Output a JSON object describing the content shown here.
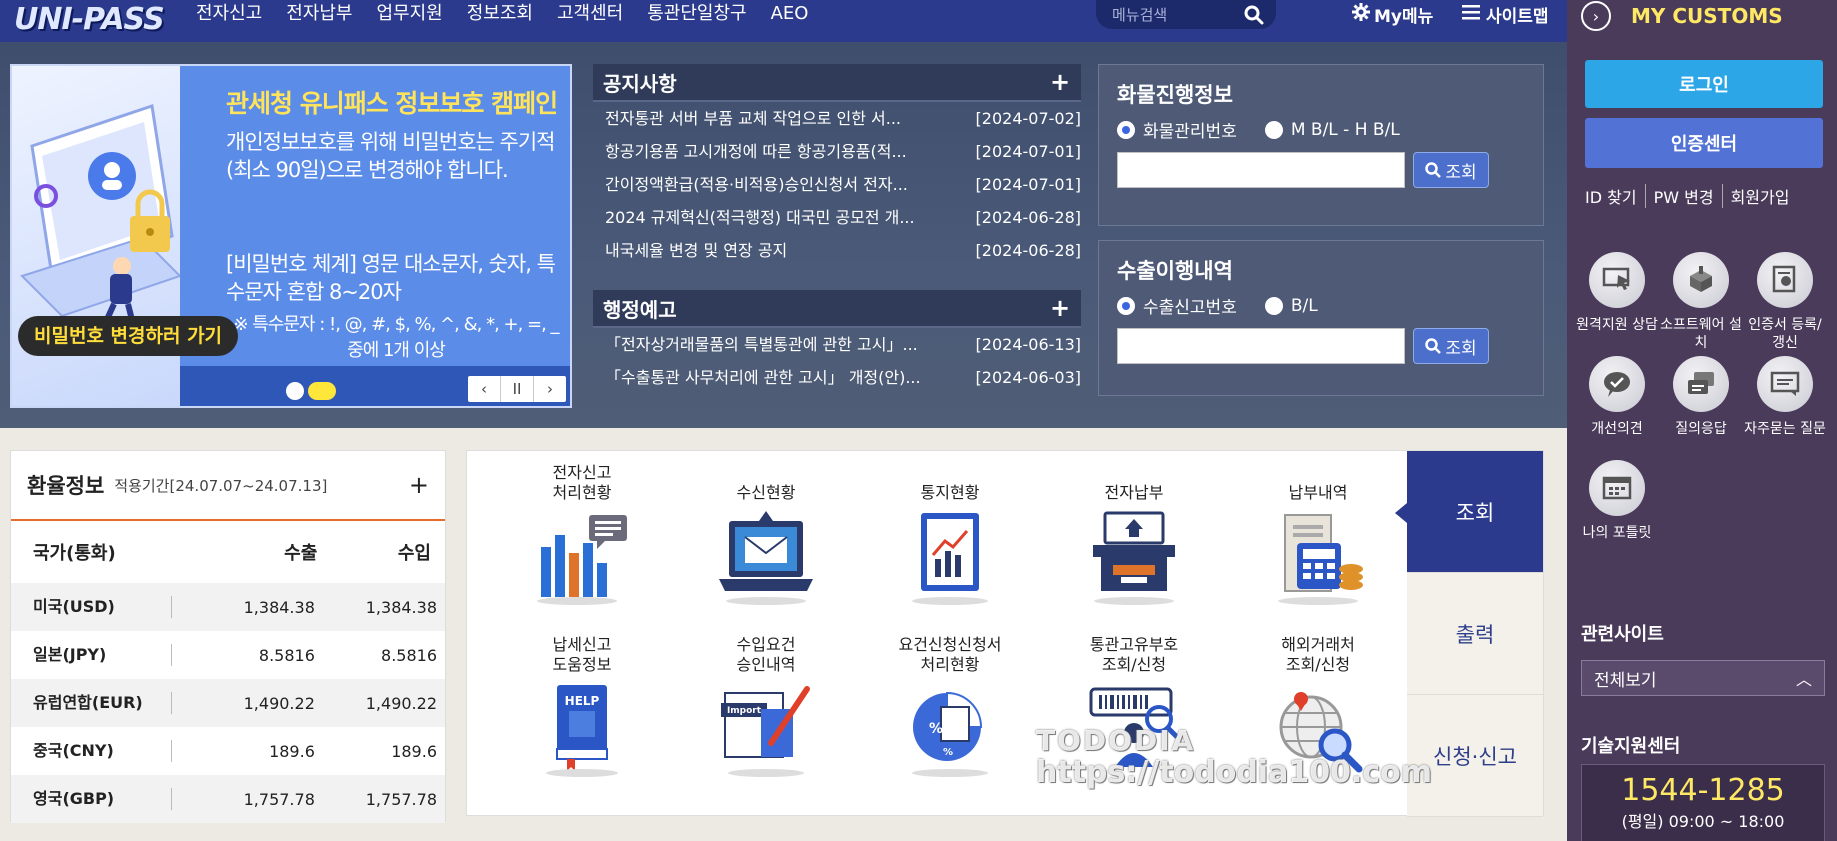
{
  "nav": {
    "logo": "UNI-PASS",
    "menu": [
      "전자신고",
      "전자납부",
      "업무지원",
      "정보조회",
      "고객센터",
      "통관단일창구",
      "AEO"
    ],
    "search_placeholder": "메뉴검색",
    "my_menu": "My메뉴",
    "site_map": "사이트맵"
  },
  "banner": {
    "title": "관세청 유니패스 정보보호 캠페인",
    "text1": "개인정보보호를 위해 비밀번호는 주기적(최소 90일)으로 변경해야 합니다.",
    "text2": "[비밀번호 체계] 영문 대소문자, 숫자, 특수문자 혼합 8~20자",
    "text3": "※ 특수문자 : !, @, #, $, %, ^, &, *, +, =, _ 중에 1개 이상",
    "cta": "비밀번호 변경하러 가기",
    "controls": [
      "‹",
      "II",
      "›"
    ],
    "active_slide_index": 1
  },
  "notice": {
    "title": "공지사항",
    "more": "+",
    "items": [
      {
        "title": "전자통관 서버 부품 교체 작업으로 인한 서...",
        "date": "[2024-07-02]"
      },
      {
        "title": "항공기용품 고시개정에 따른 항공기용품(적...",
        "date": "[2024-07-01]"
      },
      {
        "title": "간이정액환급(적용·비적용)승인신청서 전자...",
        "date": "[2024-07-01]"
      },
      {
        "title": "2024 규제혁신(적극행정) 대국민 공모전 개...",
        "date": "[2024-06-28]"
      },
      {
        "title": "내국세율 변경 및 연장 공지",
        "date": "[2024-06-28]"
      }
    ]
  },
  "admin_notice": {
    "title": "행정예고",
    "more": "+",
    "items": [
      {
        "title": "「전자상거래물품의 특별통관에 관한 고시」...",
        "date": "[2024-06-13]"
      },
      {
        "title": "「수출통관 사무처리에 관한 고시」 개정(안)...",
        "date": "[2024-06-03]"
      }
    ]
  },
  "cargo": {
    "title": "화물진행정보",
    "options": [
      "화물관리번호",
      "M B/L - H B/L"
    ],
    "selected": 0,
    "button": "조회"
  },
  "export": {
    "title": "수출이행내역",
    "options": [
      "수출신고번호",
      "B/L"
    ],
    "selected": 0,
    "button": "조회"
  },
  "fx": {
    "title": "환율정보",
    "period": "적용기간[24.07.07~24.07.13]",
    "more": "+",
    "columns": [
      "국가(통화)",
      "수출",
      "수입"
    ],
    "rows": [
      {
        "country": "미국(USD)",
        "export": "1,384.38",
        "import": "1,384.38"
      },
      {
        "country": "일본(JPY)",
        "export": "8.5816",
        "import": "8.5816"
      },
      {
        "country": "유럽연합(EUR)",
        "export": "1,490.22",
        "import": "1,490.22"
      },
      {
        "country": "중국(CNY)",
        "export": "189.6",
        "import": "189.6"
      },
      {
        "country": "영국(GBP)",
        "export": "1,757.78",
        "import": "1,757.78"
      }
    ]
  },
  "services": {
    "items": [
      {
        "label1": "전자신고",
        "label2": "처리현황",
        "icon": "bar-chart-icon"
      },
      {
        "label1": "수신현황",
        "label2": "",
        "icon": "laptop-mail-icon"
      },
      {
        "label1": "통지현황",
        "label2": "",
        "icon": "clipboard-chart-icon"
      },
      {
        "label1": "전자납부",
        "label2": "",
        "icon": "atm-icon"
      },
      {
        "label1": "납부내역",
        "label2": "",
        "icon": "receipt-coins-icon"
      },
      {
        "label1": "납세신고",
        "label2": "도움정보",
        "icon": "help-book-icon"
      },
      {
        "label1": "수입요건",
        "label2": "승인내역",
        "icon": "import-document-icon"
      },
      {
        "label1": "요건신청신청서",
        "label2": "처리현황",
        "icon": "percent-document-icon"
      },
      {
        "label1": "통관고유부호",
        "label2": "조회/신청",
        "icon": "barcode-person-icon"
      },
      {
        "label1": "해외거래처",
        "label2": "조회/신청",
        "icon": "globe-search-icon"
      }
    ],
    "tabs": [
      "조회",
      "출력",
      "신청·신고"
    ],
    "active_tab": 0
  },
  "watermark": {
    "line1": "TODODIA",
    "line2": "https://tododia100.com"
  },
  "sidebar": {
    "title": "MY CUSTOMS",
    "login": "로그인",
    "cert_center": "인증센터",
    "account_links": [
      "ID 찾기",
      "PW 변경",
      "회원가입"
    ],
    "quick": [
      {
        "label": "원격지원 상담",
        "icon": "remote-support-icon"
      },
      {
        "label": "소프트웨어 설치",
        "icon": "software-install-icon"
      },
      {
        "label": "인증서 등록/갱신",
        "icon": "certificate-icon"
      },
      {
        "label": "개선의견",
        "icon": "feedback-icon"
      },
      {
        "label": "질의응답",
        "icon": "qna-icon"
      },
      {
        "label": "자주묻는 질문",
        "icon": "faq-icon"
      },
      {
        "label": "나의 포틀릿",
        "icon": "portlet-icon"
      }
    ],
    "related_title": "관련사이트",
    "related_select": "전체보기",
    "tech_title": "기술지원센터",
    "tech_phone": "1544-1285",
    "tech_hours": "(평일) 09:00 ~ 18:00"
  }
}
